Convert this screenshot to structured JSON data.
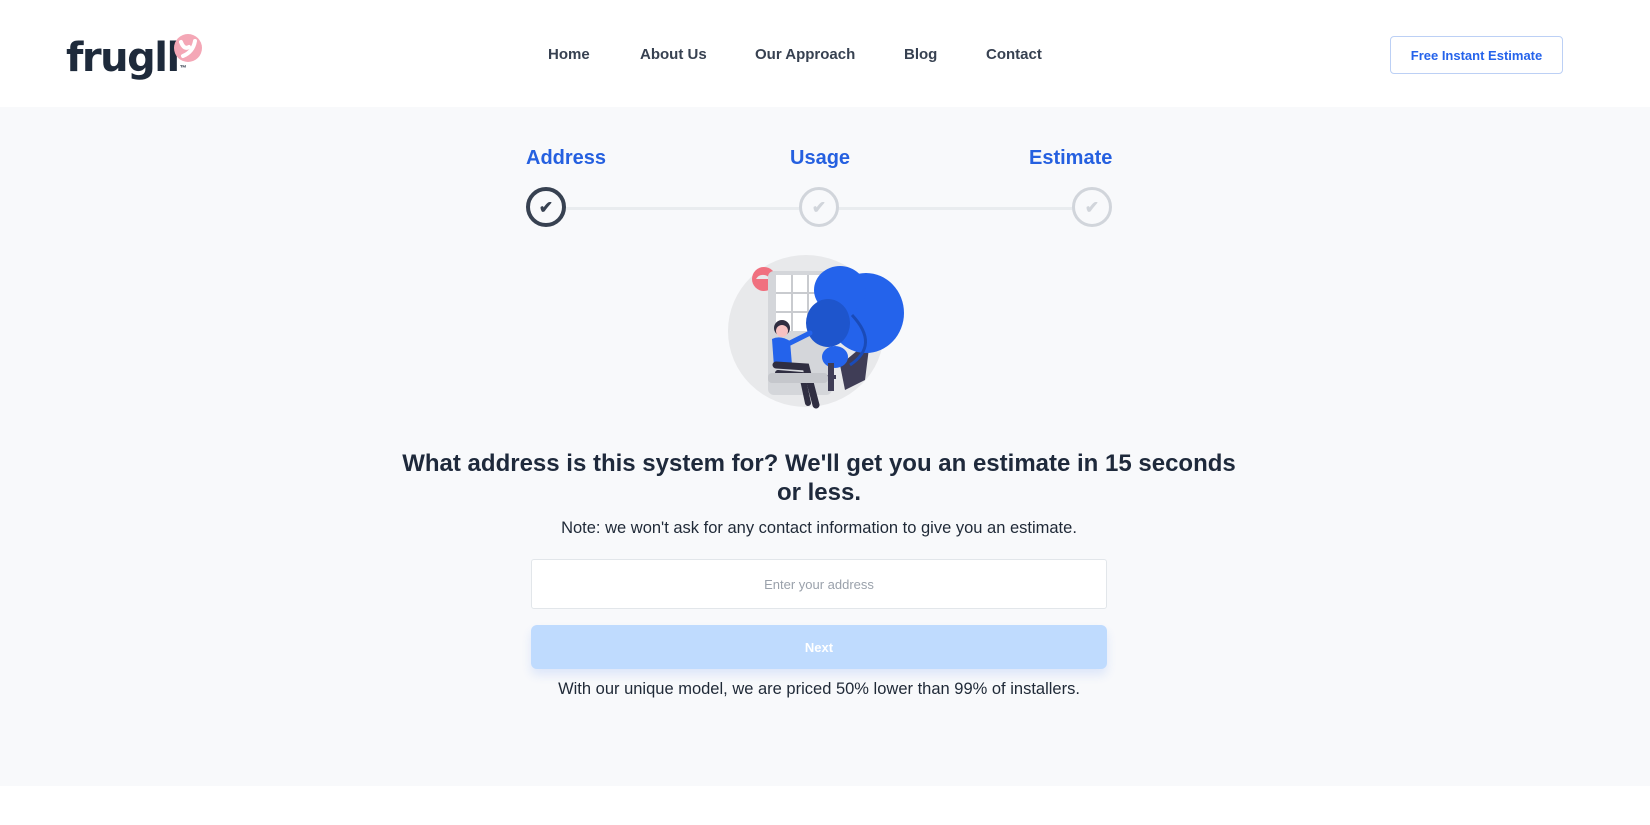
{
  "header": {
    "logo_text": "frugll",
    "logo_tm": "™",
    "nav": [
      {
        "label": "Home"
      },
      {
        "label": "About Us"
      },
      {
        "label": "Our Approach"
      },
      {
        "label": "Blog"
      },
      {
        "label": "Contact"
      }
    ],
    "cta_label": "Free Instant Estimate"
  },
  "steps": [
    {
      "label": "Address",
      "icon": "check-icon",
      "state": "completed"
    },
    {
      "label": "Usage",
      "icon": "check-icon",
      "state": "pending"
    },
    {
      "label": "Estimate",
      "icon": "check-icon",
      "state": "pending"
    }
  ],
  "main": {
    "headline": "What address is this system for? We'll get you an estimate in 15 seconds or less.",
    "note": "Note: we won't ask for any contact information to give you an estimate.",
    "address_input": {
      "value": "",
      "placeholder": "Enter your address"
    },
    "next_label": "Next",
    "model_note": "With our unique model, we are priced 50% lower than 99% of installers."
  },
  "colors": {
    "accent": "#2563eb",
    "step_label": "#2560e0",
    "logo_pink": "#f4a7b6",
    "text_dark": "#1e293b",
    "next_disabled": "#bfdbfe",
    "main_bg": "#f8f9fb"
  }
}
